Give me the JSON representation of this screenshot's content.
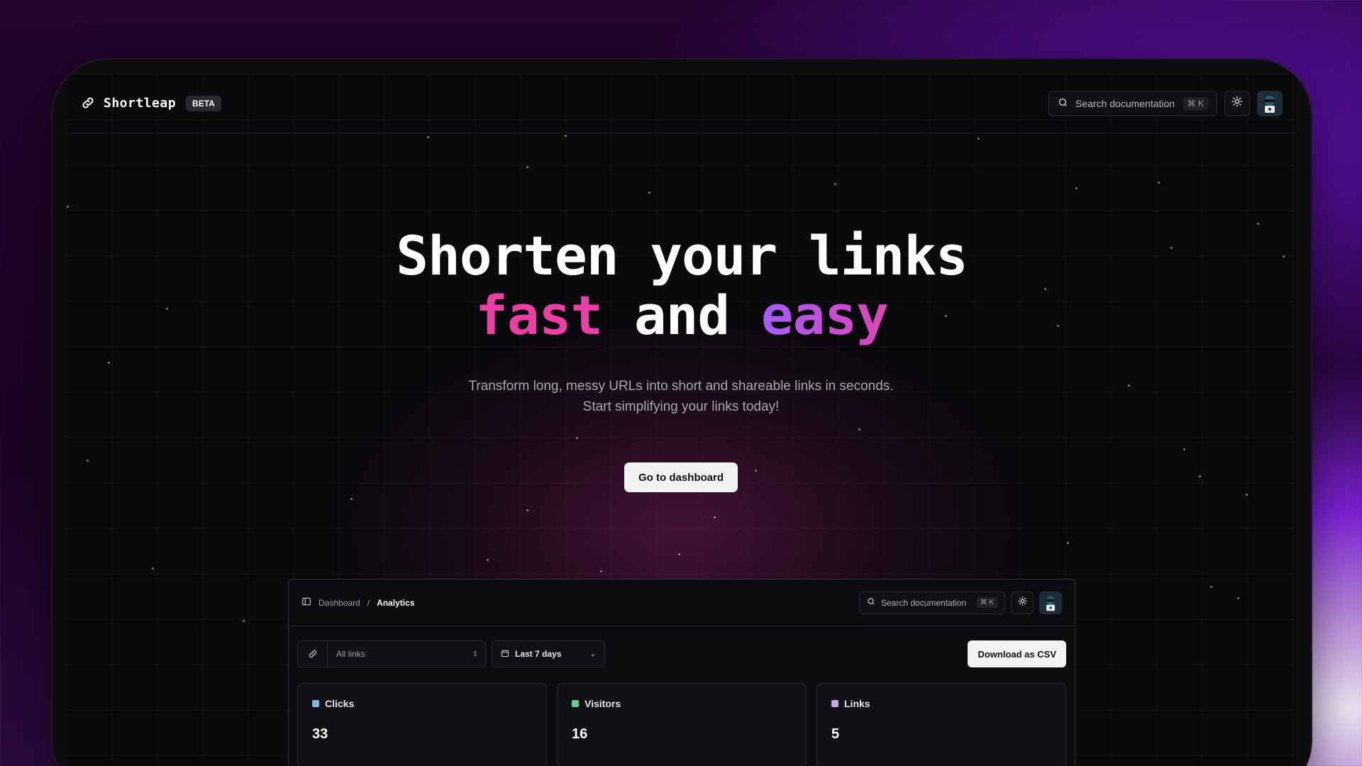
{
  "nav": {
    "brand": "Shortleap",
    "badge": "BETA",
    "search_placeholder": "Search documentation",
    "shortcut": "⌘ K"
  },
  "hero": {
    "title_line1": "Shorten your links",
    "word_fast": "fast",
    "word_and": "and",
    "word_easy": "easy",
    "subtitle": "Transform long, messy URLs into short and shareable links in seconds. Start simplifying your links today!",
    "cta": "Go to dashboard"
  },
  "dashboard": {
    "breadcrumb_root": "Dashboard",
    "breadcrumb_sep": "/",
    "breadcrumb_current": "Analytics",
    "search_placeholder": "Search documentation",
    "shortcut": "⌘ K",
    "link_filter": "All links",
    "date_filter": "Last 7 days",
    "download": "Download as CSV",
    "cards": [
      {
        "label": "Clicks",
        "value": "33",
        "color": "#7fb6ef"
      },
      {
        "label": "Visitors",
        "value": "16",
        "color": "#5fd08a"
      },
      {
        "label": "Links",
        "value": "5",
        "color": "#c9a6ef"
      }
    ]
  },
  "colors": {
    "accent_pink": "#ec3fa5",
    "accent_purple": "#a45cf6"
  }
}
